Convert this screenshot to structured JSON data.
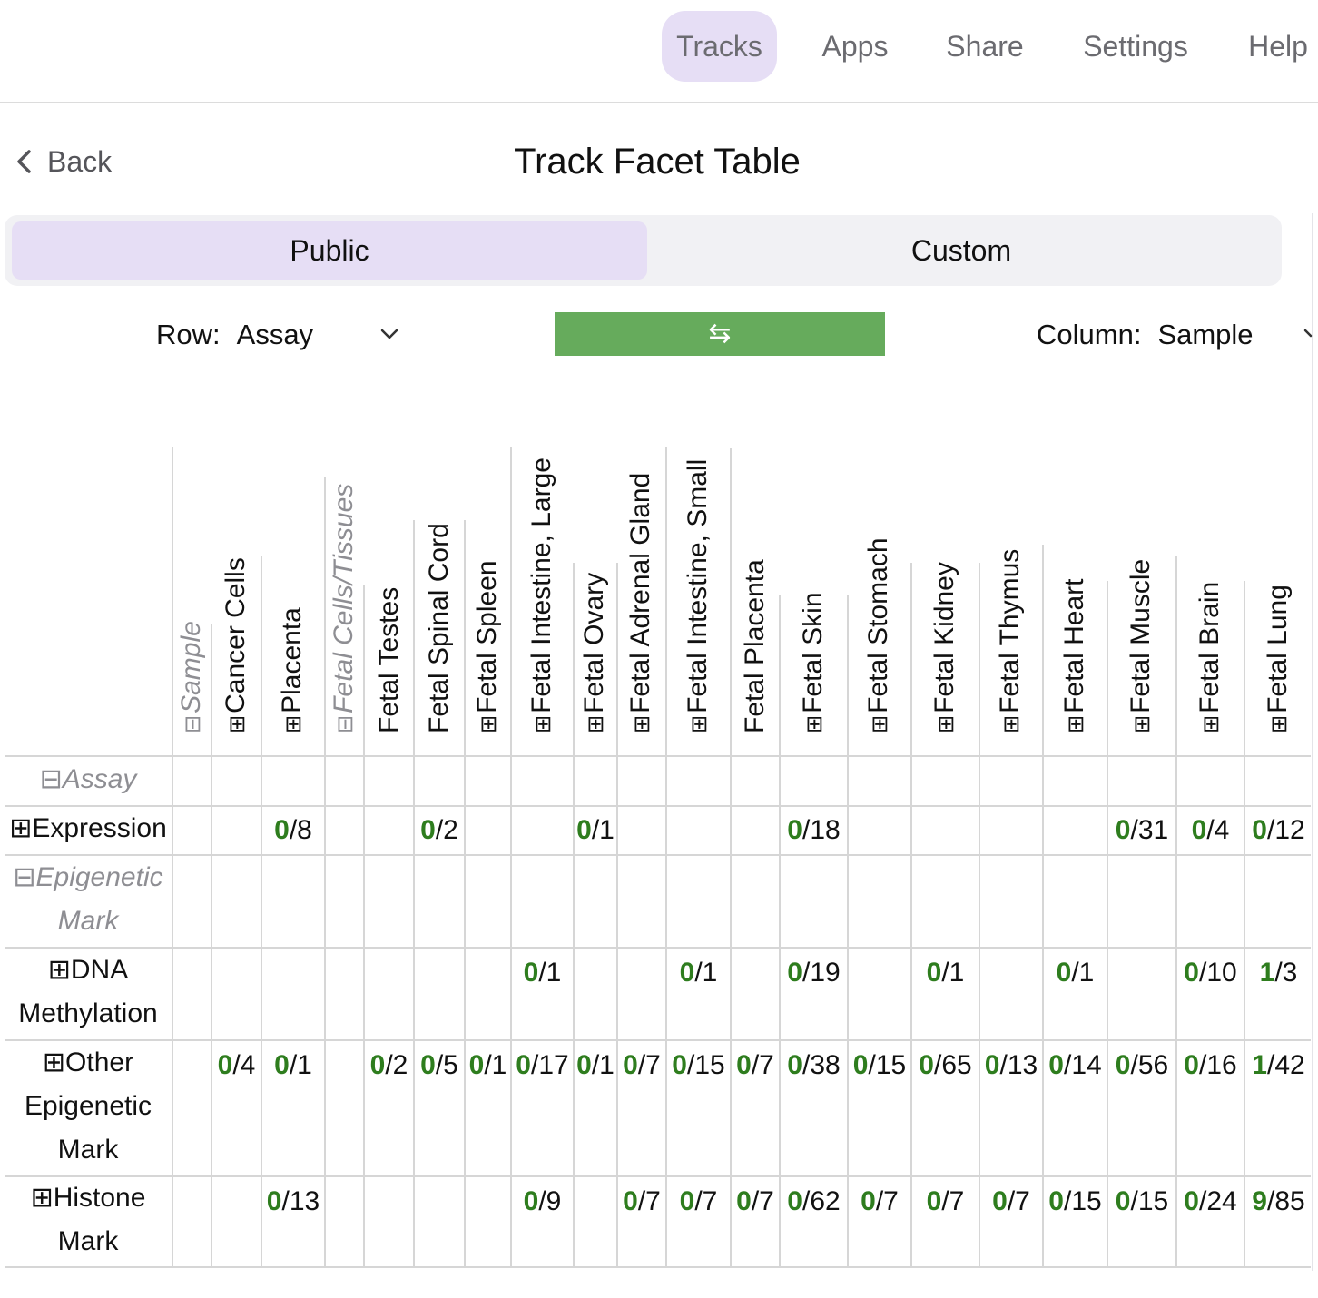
{
  "nav": {
    "items": [
      {
        "label": "Tracks",
        "active": true
      },
      {
        "label": "Apps",
        "active": false
      },
      {
        "label": "Share",
        "active": false
      },
      {
        "label": "Settings",
        "active": false
      },
      {
        "label": "Help",
        "active": false
      }
    ]
  },
  "header": {
    "back_label": "Back",
    "title": "Track Facet Table"
  },
  "segment": {
    "public_label": "Public",
    "custom_label": "Custom",
    "selected": "Public"
  },
  "controls": {
    "row_label": "Row:",
    "row_value": "Assay",
    "swap_symbol": "⇆",
    "column_label": "Column:",
    "column_value": "Sample"
  },
  "icons": {
    "expand": "⊞",
    "collapse": "⊟",
    "back": "chevron-left-icon",
    "dropdown": "chevron-down-icon"
  },
  "colors": {
    "accent_selected": "#e6def5",
    "swap_button": "#66ab5c",
    "count_green": "#2e7d1e",
    "group_gray": "#8e8e93"
  },
  "table": {
    "columns": [
      {
        "label": "Sample",
        "expander": "⊟",
        "group": true
      },
      {
        "label": "Cancer Cells",
        "expander": "⊞",
        "group": false
      },
      {
        "label": "Placenta",
        "expander": "⊞",
        "group": false
      },
      {
        "label": "Fetal Cells/Tissues",
        "expander": "⊟",
        "group": true
      },
      {
        "label": "Fetal Testes",
        "expander": "",
        "group": false
      },
      {
        "label": "Fetal Spinal Cord",
        "expander": "",
        "group": false
      },
      {
        "label": "Fetal Spleen",
        "expander": "⊞",
        "group": false
      },
      {
        "label": "Fetal Intestine, Large",
        "expander": "⊞",
        "group": false
      },
      {
        "label": "Fetal Ovary",
        "expander": "⊞",
        "group": false
      },
      {
        "label": "Fetal Adrenal Gland",
        "expander": "⊞",
        "group": false
      },
      {
        "label": "Fetal Intestine, Small",
        "expander": "⊞",
        "group": false
      },
      {
        "label": "Fetal Placenta",
        "expander": "",
        "group": false
      },
      {
        "label": "Fetal Skin",
        "expander": "⊞",
        "group": false
      },
      {
        "label": "Fetal Stomach",
        "expander": "⊞",
        "group": false
      },
      {
        "label": "Fetal Kidney",
        "expander": "⊞",
        "group": false
      },
      {
        "label": "Fetal Thymus",
        "expander": "⊞",
        "group": false
      },
      {
        "label": "Fetal Heart",
        "expander": "⊞",
        "group": false
      },
      {
        "label": "Fetal Muscle",
        "expander": "⊞",
        "group": false
      },
      {
        "label": "Fetal Brain",
        "expander": "⊞",
        "group": false
      },
      {
        "label": "Fetal Lung",
        "expander": "⊞",
        "group": false
      }
    ],
    "rows": [
      {
        "label_lines": [
          "⊟Assay"
        ],
        "group": true,
        "cells": [
          null,
          null,
          null,
          null,
          null,
          null,
          null,
          null,
          null,
          null,
          null,
          null,
          null,
          null,
          null,
          null,
          null,
          null,
          null,
          null
        ]
      },
      {
        "label_lines": [
          "⊞Expression"
        ],
        "group": false,
        "cells": [
          null,
          null,
          [
            "0",
            "/8"
          ],
          null,
          null,
          [
            "0",
            "/2"
          ],
          null,
          null,
          [
            "0",
            "/1"
          ],
          null,
          null,
          null,
          [
            "0",
            "/18"
          ],
          null,
          null,
          null,
          null,
          [
            "0",
            "/31"
          ],
          [
            "0",
            "/4"
          ],
          [
            "0",
            "/12"
          ]
        ]
      },
      {
        "label_lines": [
          "⊟Epigenetic",
          "Mark"
        ],
        "group": true,
        "cells": [
          null,
          null,
          null,
          null,
          null,
          null,
          null,
          null,
          null,
          null,
          null,
          null,
          null,
          null,
          null,
          null,
          null,
          null,
          null,
          null
        ]
      },
      {
        "label_lines": [
          "⊞DNA",
          "Methylation"
        ],
        "group": false,
        "cells": [
          null,
          null,
          null,
          null,
          null,
          null,
          null,
          [
            "0",
            "/1"
          ],
          null,
          null,
          [
            "0",
            "/1"
          ],
          null,
          [
            "0",
            "/19"
          ],
          null,
          [
            "0",
            "/1"
          ],
          null,
          [
            "0",
            "/1"
          ],
          null,
          [
            "0",
            "/10"
          ],
          [
            "1",
            "/3"
          ]
        ]
      },
      {
        "label_lines": [
          "⊞Other",
          "Epigenetic",
          "Mark"
        ],
        "group": false,
        "cells": [
          null,
          [
            "0",
            "/4"
          ],
          [
            "0",
            "/1"
          ],
          null,
          [
            "0",
            "/2"
          ],
          [
            "0",
            "/5"
          ],
          [
            "0",
            "/1"
          ],
          [
            "0",
            "/17"
          ],
          [
            "0",
            "/1"
          ],
          [
            "0",
            "/7"
          ],
          [
            "0",
            "/15"
          ],
          [
            "0",
            "/7"
          ],
          [
            "0",
            "/38"
          ],
          [
            "0",
            "/15"
          ],
          [
            "0",
            "/65"
          ],
          [
            "0",
            "/13"
          ],
          [
            "0",
            "/14"
          ],
          [
            "0",
            "/56"
          ],
          [
            "0",
            "/16"
          ],
          [
            "1",
            "/42"
          ]
        ]
      },
      {
        "label_lines": [
          "⊞Histone",
          "Mark"
        ],
        "group": false,
        "cells": [
          null,
          null,
          [
            "0",
            "/13"
          ],
          null,
          null,
          null,
          null,
          [
            "0",
            "/9"
          ],
          null,
          [
            "0",
            "/7"
          ],
          [
            "0",
            "/7"
          ],
          [
            "0",
            "/7"
          ],
          [
            "0",
            "/62"
          ],
          [
            "0",
            "/7"
          ],
          [
            "0",
            "/7"
          ],
          [
            "0",
            "/7"
          ],
          [
            "0",
            "/15"
          ],
          [
            "0",
            "/15"
          ],
          [
            "0",
            "/24"
          ],
          [
            "9",
            "/85"
          ]
        ]
      }
    ]
  }
}
